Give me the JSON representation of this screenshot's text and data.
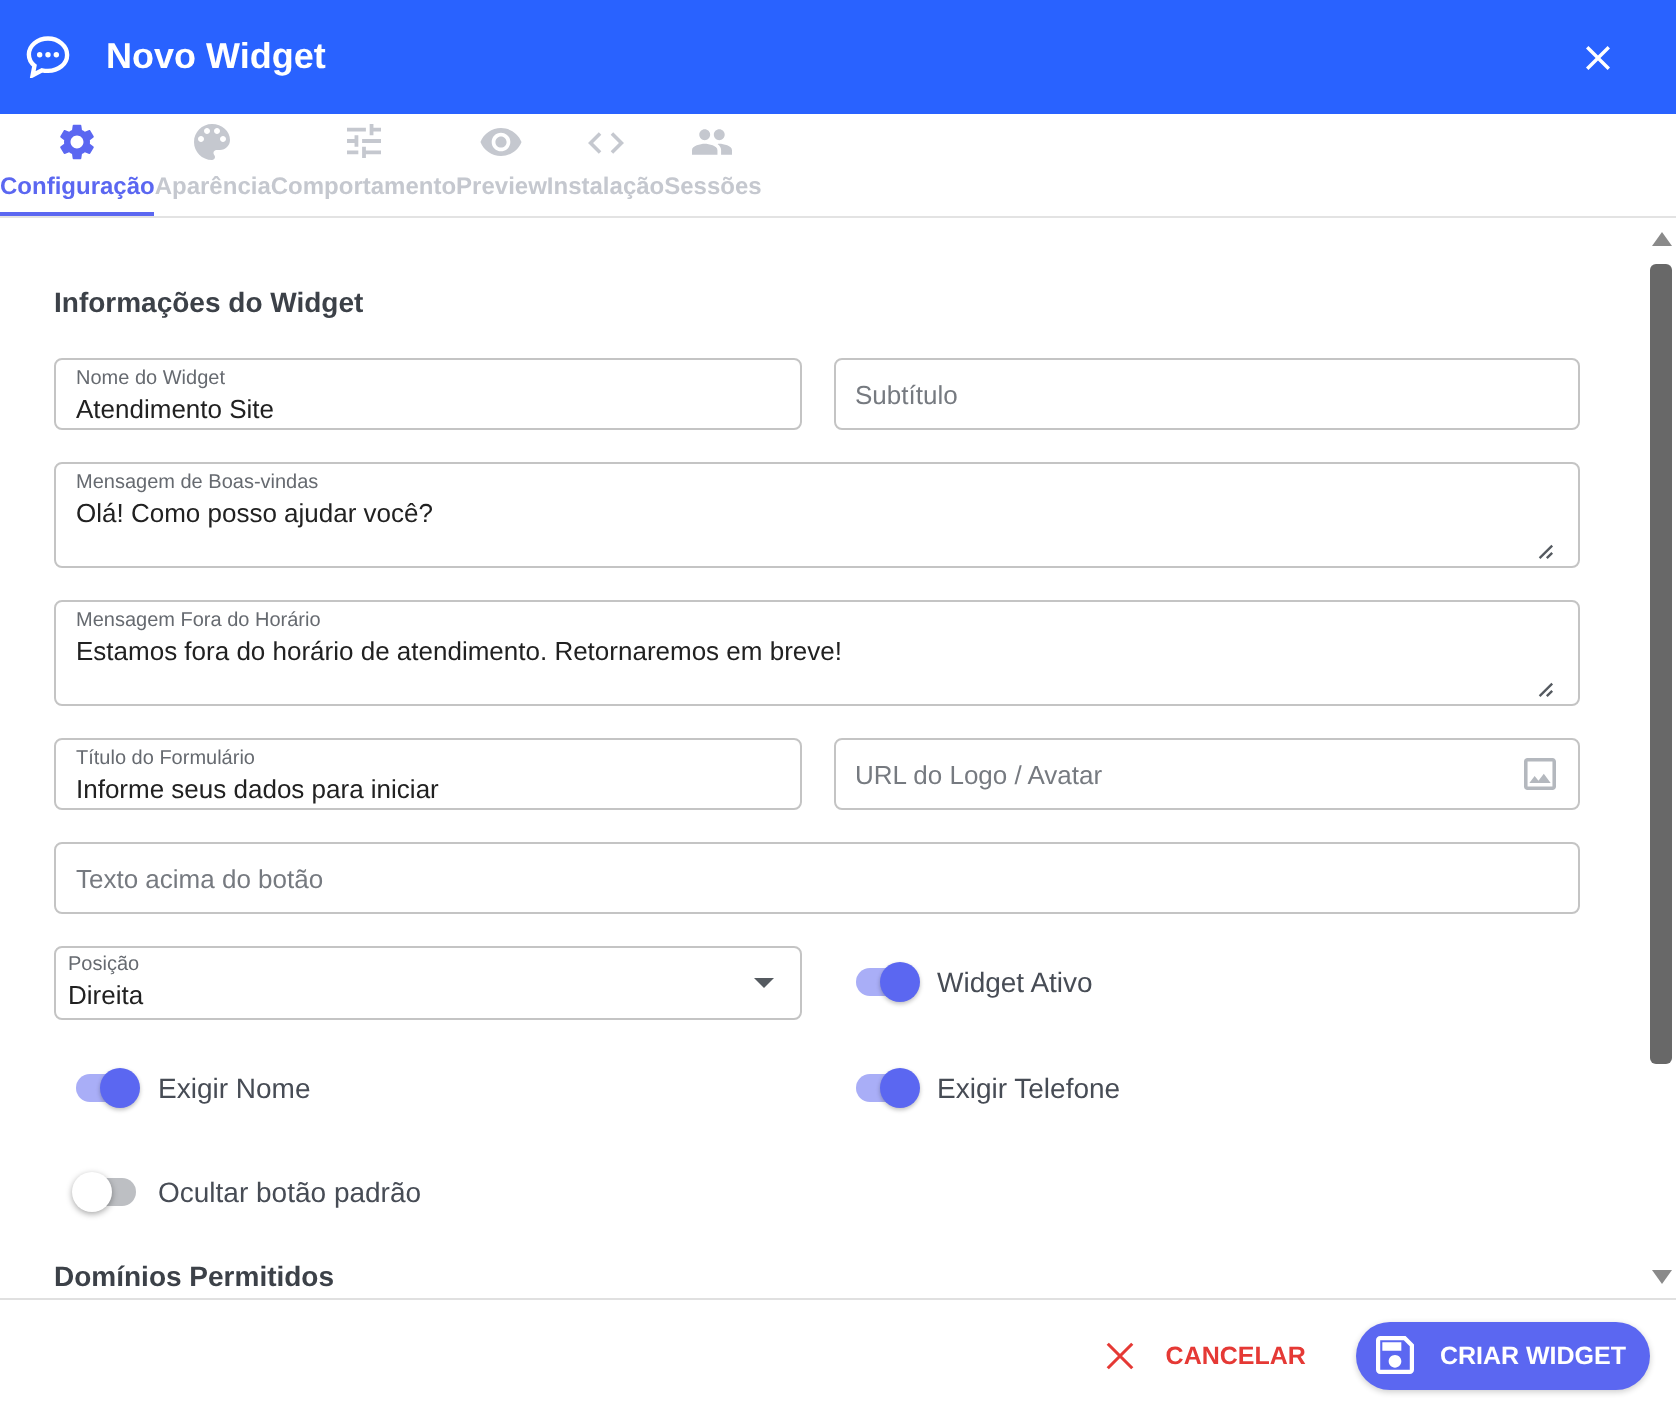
{
  "window": {
    "title": "Novo Widget"
  },
  "tabs": [
    {
      "label": "Configuração",
      "selected": true
    },
    {
      "label": "Aparência",
      "selected": false
    },
    {
      "label": "Comportamento",
      "selected": false
    },
    {
      "label": "Preview",
      "selected": false
    },
    {
      "label": "Instalação",
      "selected": false
    },
    {
      "label": "Sessões",
      "selected": false
    }
  ],
  "sections": [
    {
      "title": "Informações do Widget",
      "rows": [
        [
          {
            "kind": "text",
            "label": "Nome do Widget",
            "value": "Atendimento Site"
          },
          {
            "kind": "text",
            "placeholder": "Subtítulo"
          }
        ],
        [
          {
            "kind": "textarea",
            "label": "Mensagem de Boas-vindas",
            "value": "Olá! Como posso ajudar você?"
          }
        ],
        [
          {
            "kind": "textarea",
            "label": "Mensagem Fora do Horário",
            "value": "Estamos fora do horário de atendimento. Retornaremos em breve!"
          }
        ],
        [
          {
            "kind": "text",
            "label": "Título do Formulário",
            "value": "Informe seus dados para iniciar"
          },
          {
            "kind": "image_url",
            "placeholder": "URL do Logo / Avatar"
          }
        ],
        [
          {
            "kind": "text",
            "placeholder": "Texto acima do botão"
          }
        ],
        [
          {
            "kind": "select",
            "label": "Posição",
            "value": "Direita"
          },
          {
            "kind": "toggle",
            "label": "Widget Ativo",
            "on": true
          }
        ],
        [
          {
            "kind": "toggle",
            "label": "Exigir Nome",
            "on": true
          },
          {
            "kind": "toggle",
            "label": "Exigir Telefone",
            "on": true
          }
        ],
        [
          {
            "kind": "toggle",
            "label": "Ocultar botão padrão",
            "on": false
          }
        ]
      ]
    },
    {
      "title": "Domínios Permitidos"
    }
  ],
  "actions": [
    {
      "kind": "cancel",
      "label": "CANCELAR"
    },
    {
      "kind": "primary",
      "label": "CRIAR WIDGET"
    }
  ]
}
